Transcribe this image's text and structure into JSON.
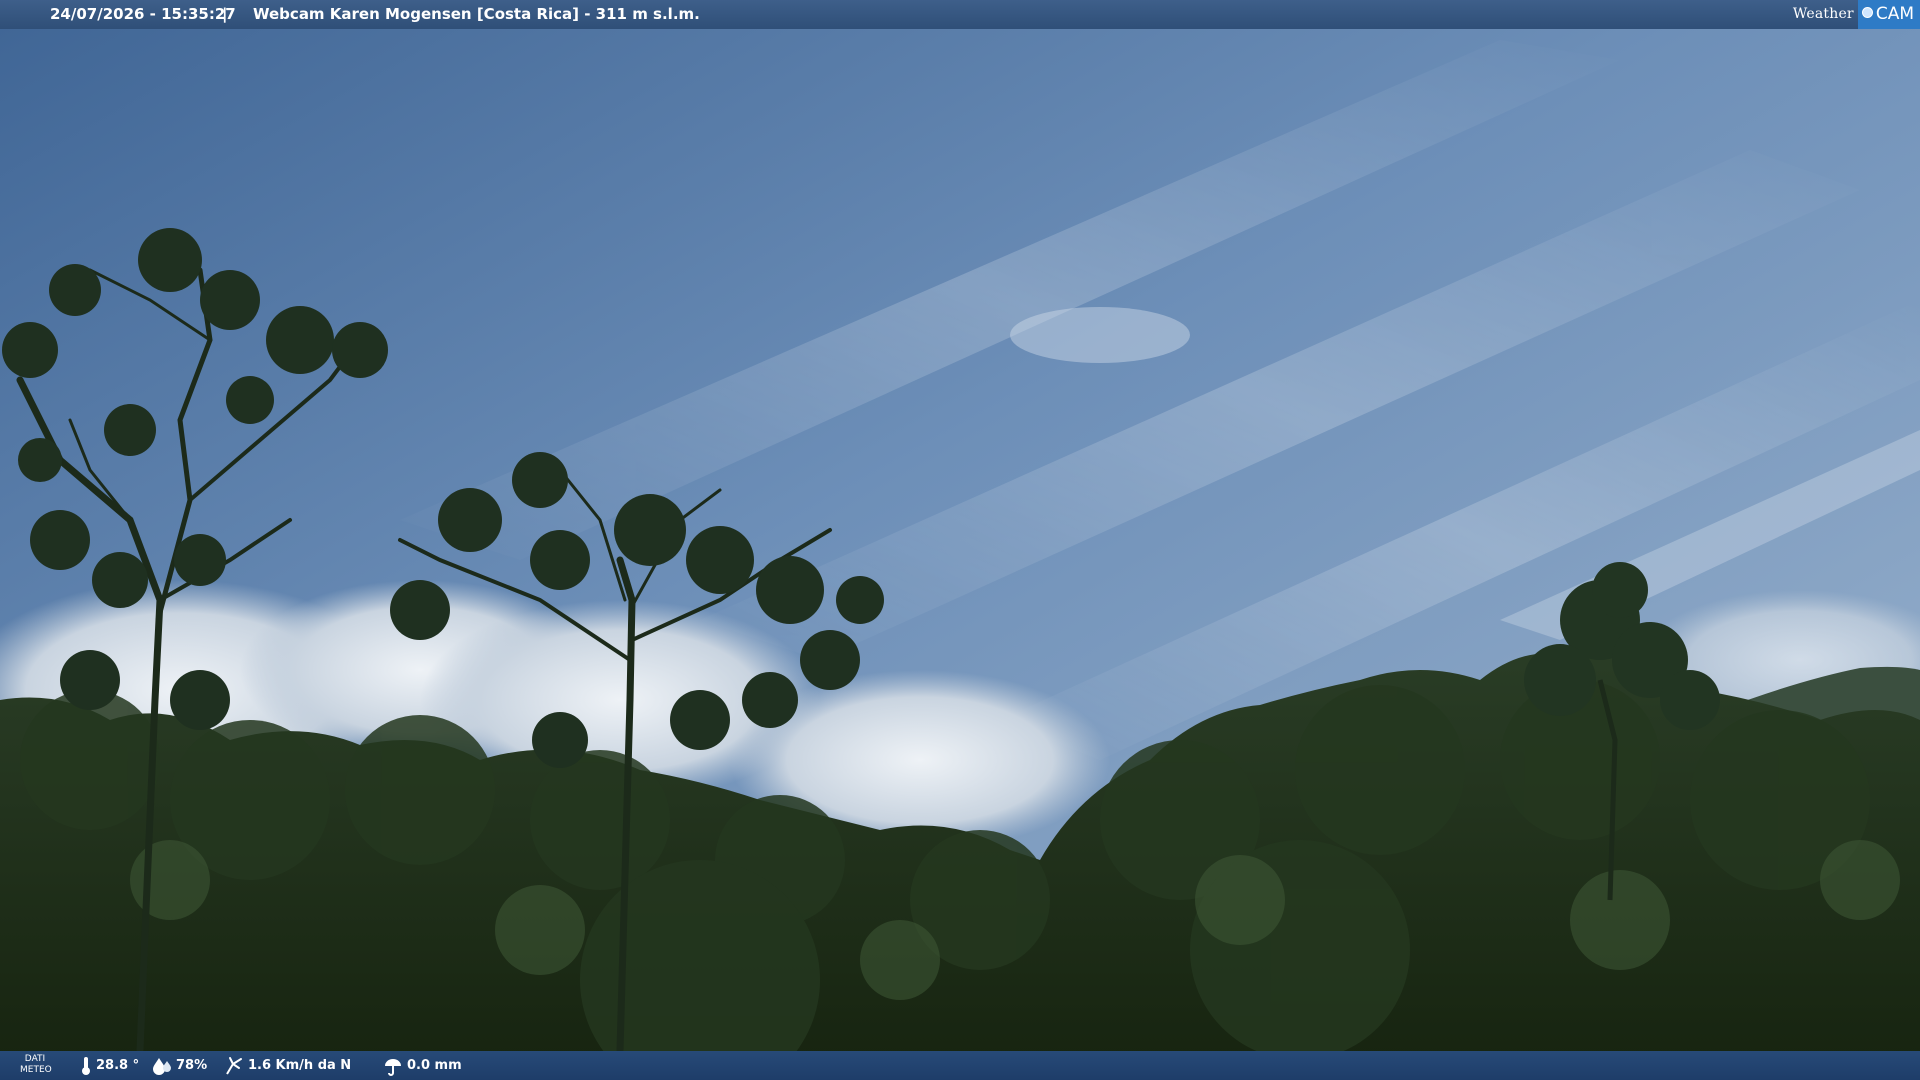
{
  "header": {
    "datetime": "24/07/2026 - 15:35:27",
    "separator": "|",
    "title": "Webcam Karen Mogensen [Costa Rica] - 311 m s.l.m.",
    "logo_weather": "Weather",
    "logo_cam": "CAM"
  },
  "weather": {
    "label_line1": "DATI",
    "label_line2": "METEO",
    "temperature": "28.8 °",
    "humidity": "78%",
    "wind": "1.6 Km/h da N",
    "rain": "0.0 mm",
    "icons": [
      "thermometer-icon",
      "humidity-icon",
      "wind-icon",
      "rain-icon"
    ]
  },
  "colors": {
    "sky": "#5d80ad",
    "foliage": "#1f2f1c",
    "bar": "#2f4f78",
    "logo_accent": "#2e7bc6"
  }
}
